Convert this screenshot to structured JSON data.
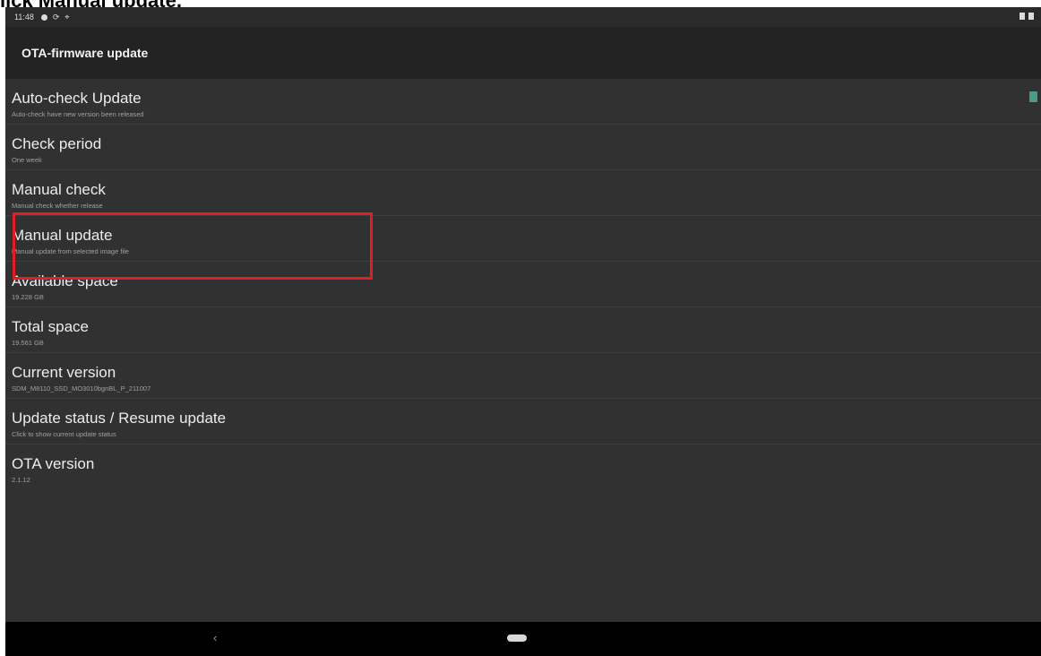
{
  "caption": "lick Manual update.",
  "status_bar": {
    "time": "11:48"
  },
  "app_bar": {
    "title": "OTA-firmware update"
  },
  "settings": [
    {
      "title": "Auto-check Update",
      "summary": "Auto-check have new version been released"
    },
    {
      "title": "Check period",
      "summary": "One week"
    },
    {
      "title": "Manual check",
      "summary": "Manual check whether release"
    },
    {
      "title": "Manual update",
      "summary": "Manual update from selected image file"
    },
    {
      "title": "Available space",
      "summary": "19.228 GB"
    },
    {
      "title": "Total space",
      "summary": "19.561 GB"
    },
    {
      "title": "Current version",
      "summary": "SDM_M8110_SSD_MO3010bgnBL_P_211007"
    },
    {
      "title": "Update status / Resume update",
      "summary": "Click to show current update status"
    },
    {
      "title": "OTA version",
      "summary": "2.1.12"
    }
  ],
  "colors": {
    "background": "#313131",
    "app_bar": "#232323",
    "highlight": "#e02020",
    "checkbox": "#4a9c8a"
  },
  "icons": {
    "back": "back-icon",
    "home": "home-icon",
    "checkbox": "checkbox-icon"
  }
}
